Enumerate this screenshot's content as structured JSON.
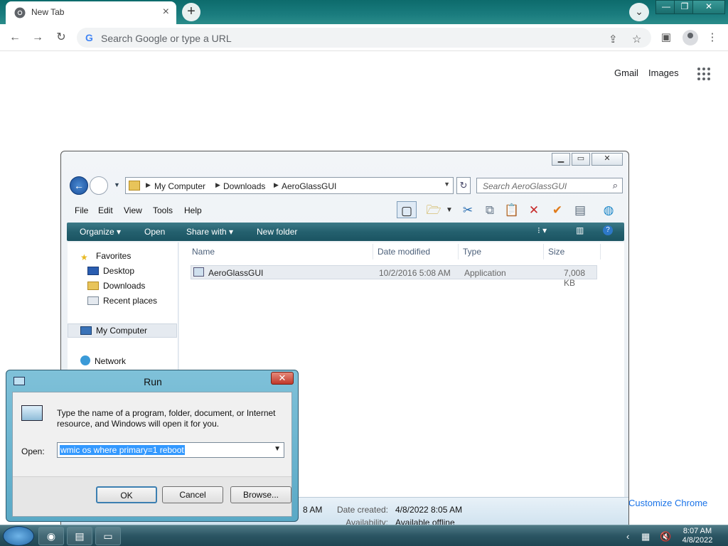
{
  "chrome": {
    "tab_title": "New Tab",
    "omnibox_placeholder": "Search Google or type a URL",
    "links": {
      "gmail": "Gmail",
      "images": "Images"
    },
    "customize": "Customize Chrome"
  },
  "explorer": {
    "breadcrumb": [
      "My Computer",
      "Downloads",
      "AeroGlassGUI"
    ],
    "search_placeholder": "Search AeroGlassGUI",
    "menu": [
      "File",
      "Edit",
      "View",
      "Tools",
      "Help"
    ],
    "commands": [
      "Organize",
      "Open",
      "Share with",
      "New folder"
    ],
    "nav": {
      "favorites": "Favorites",
      "desktop": "Desktop",
      "downloads": "Downloads",
      "recent": "Recent places",
      "my_computer": "My Computer",
      "network": "Network"
    },
    "columns": [
      "Name",
      "Date modified",
      "Type",
      "Size"
    ],
    "files": [
      {
        "name": "AeroGlassGUI",
        "date": "10/2/2016 5:08 AM",
        "type": "Application",
        "size": "7,008 KB"
      }
    ],
    "details": {
      "modified_tail": "8 AM",
      "created_label": "Date created:",
      "created_value": "4/8/2022 8:05 AM",
      "availability_label": "Availability:",
      "availability_value": "Available offline"
    }
  },
  "run": {
    "title": "Run",
    "description": "Type the name of a program, folder, document, or Internet resource, and Windows will open it for you.",
    "open_label": "Open:",
    "command": "wmic os where primary=1 reboot",
    "buttons": {
      "ok": "OK",
      "cancel": "Cancel",
      "browse": "Browse..."
    }
  },
  "taskbar": {
    "time": "8:07 AM",
    "date": "4/8/2022"
  },
  "icons": [
    "chrome-icon",
    "close-icon",
    "plus-icon",
    "back-icon",
    "forward-icon",
    "reload-icon",
    "share-icon",
    "star-icon",
    "sidepanel-icon",
    "profile-icon",
    "more-icon",
    "apps-icon",
    "folder-icon",
    "search-icon",
    "refresh-icon",
    "run-icon",
    "start-icon"
  ]
}
